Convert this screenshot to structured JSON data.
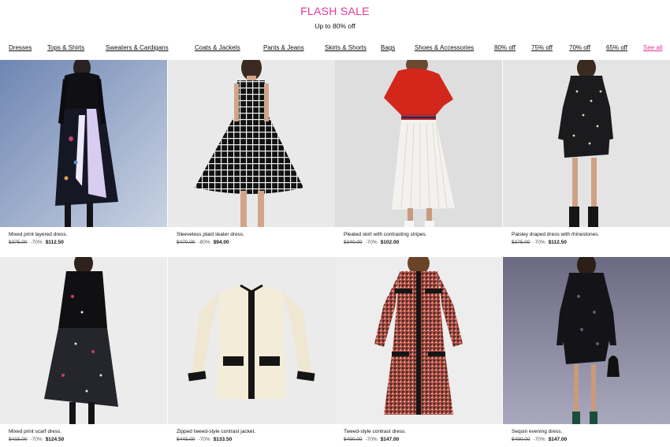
{
  "header": {
    "title": "FLASH SALE",
    "subtitle": "Up to 80% off"
  },
  "nav": {
    "items": [
      {
        "label": "Dresses"
      },
      {
        "label": "Tops & Shirts"
      },
      {
        "label": "Sweaters & Cardigans"
      },
      {
        "label": "Coats & Jackets"
      },
      {
        "label": "Pants & Jeans"
      },
      {
        "label": "Skirts & Shorts"
      },
      {
        "label": "Bags"
      },
      {
        "label": "Shoes & Accessories"
      },
      {
        "label": "80% off"
      },
      {
        "label": "75% off"
      },
      {
        "label": "70% off"
      },
      {
        "label": "65% off"
      },
      {
        "label": "See all"
      }
    ]
  },
  "products": [
    {
      "name": "Mixed print layered dress.",
      "old_price": "$375.00",
      "discount": "-70%",
      "price": "$112.50"
    },
    {
      "name": "Sleeveless plaid skater dress.",
      "old_price": "$470.00",
      "discount": "-80%",
      "price": "$94.00"
    },
    {
      "name": "Pleated skirt with contrasting stripes.",
      "old_price": "$340.00",
      "discount": "-70%",
      "price": "$102.00"
    },
    {
      "name": "Paisley draped dress with rhinestones.",
      "old_price": "$375.00",
      "discount": "-70%",
      "price": "$112.50"
    },
    {
      "name": "Mixed print scarf dress.",
      "old_price": "$415.00",
      "discount": "-70%",
      "price": "$124.50"
    },
    {
      "name": "Zipped tweed-style contrast jacket.",
      "old_price": "$445.00",
      "discount": "-70%",
      "price": "$133.50"
    },
    {
      "name": "Tweed-style contrast dress.",
      "old_price": "$490.00",
      "discount": "-70%",
      "price": "$147.00"
    },
    {
      "name": "Sequin evening dress.",
      "old_price": "$490.00",
      "discount": "-70%",
      "price": "$147.00"
    }
  ],
  "colors": {
    "accent": "#e4369a"
  }
}
